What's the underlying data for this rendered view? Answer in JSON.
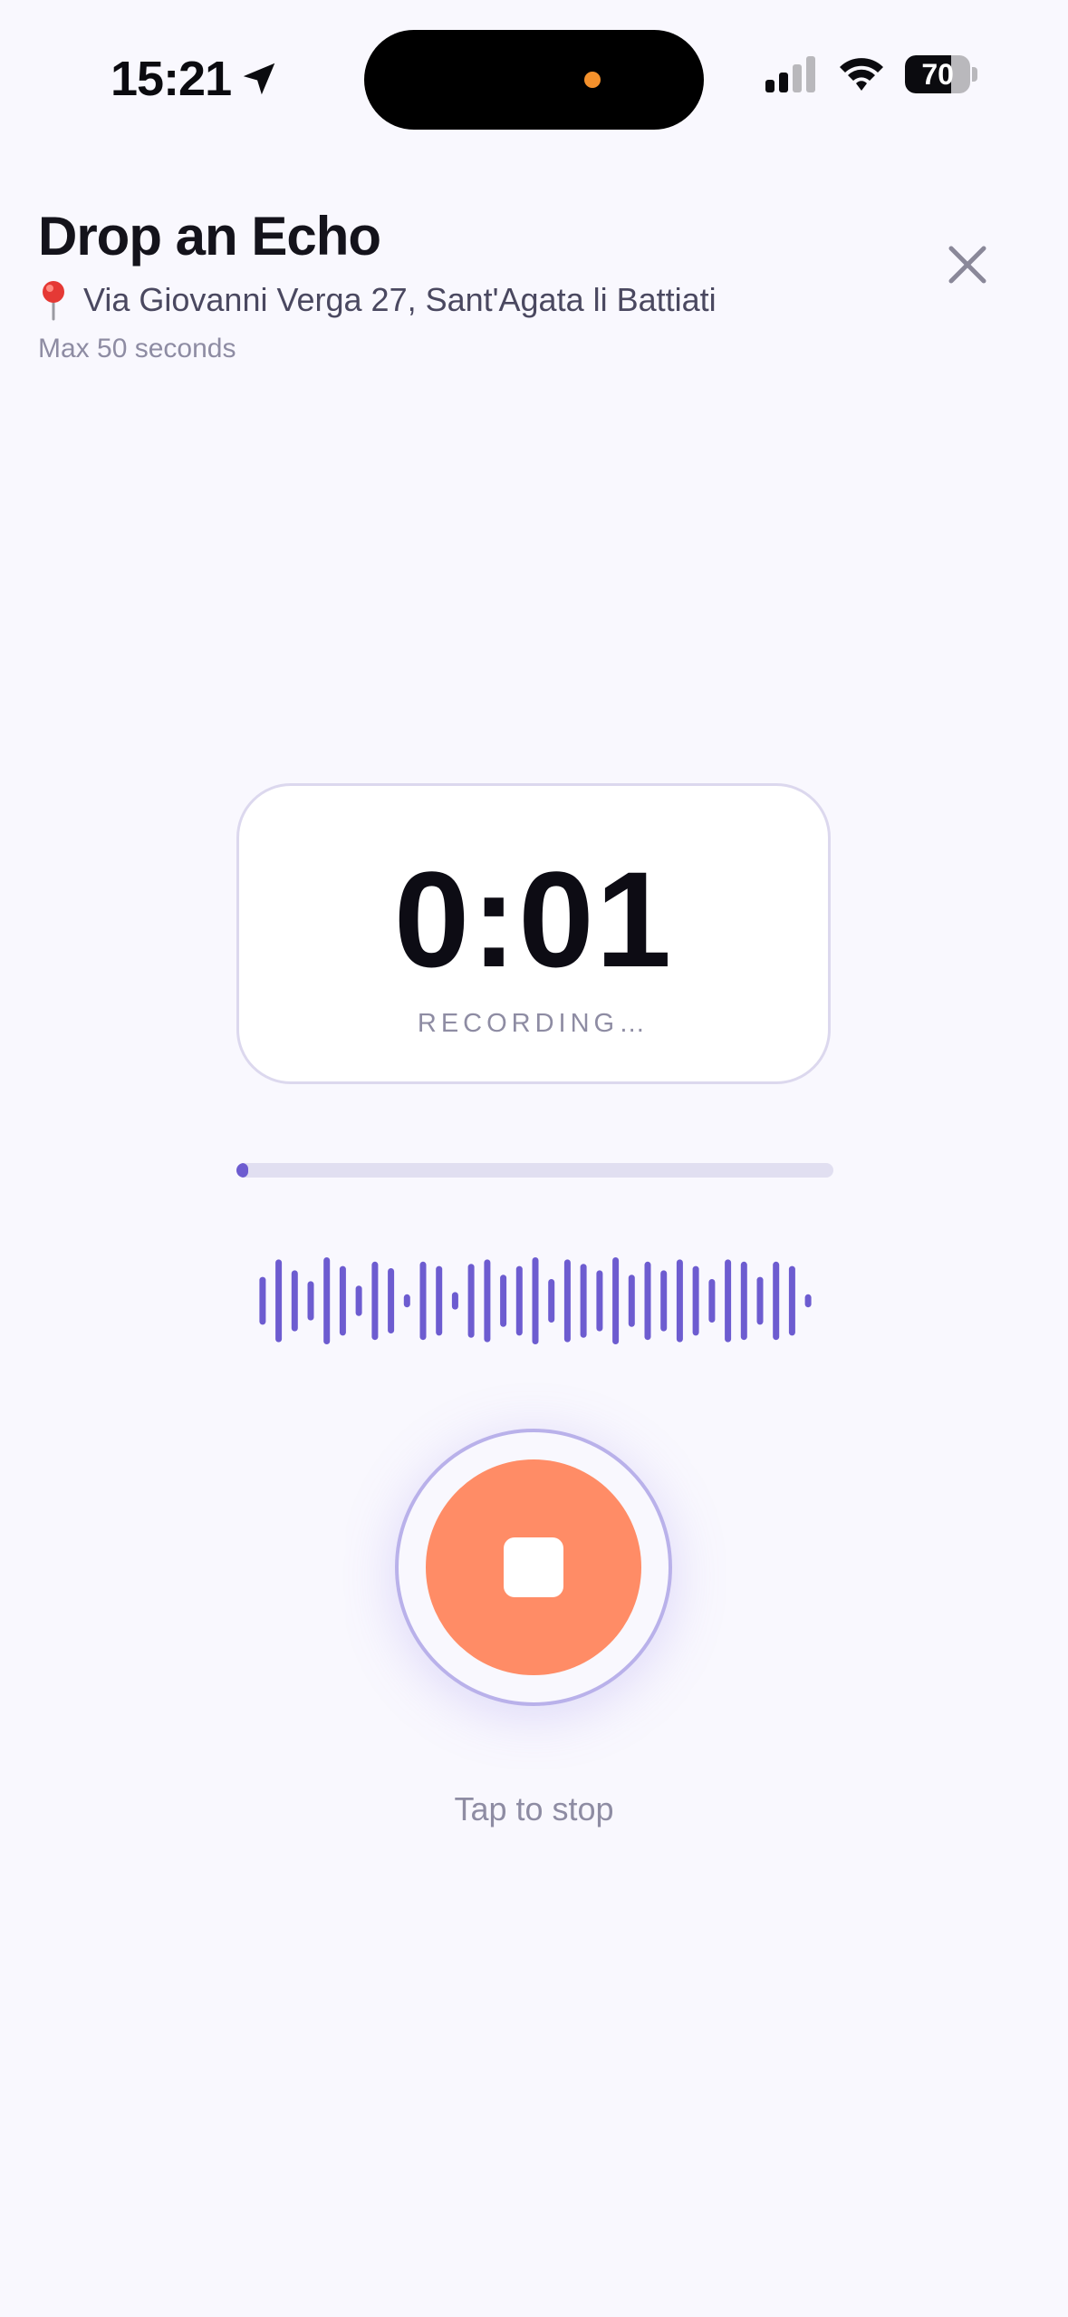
{
  "status_bar": {
    "time": "15:21",
    "battery_level": "70",
    "battery_fraction": 0.7,
    "icons": [
      "location-arrow-icon",
      "signal-icon",
      "wifi-icon",
      "battery-icon"
    ],
    "island_indicator_color": "#f4912c"
  },
  "header": {
    "title": "Drop an Echo",
    "location_icon": "pin-icon",
    "location": "Via Giovanni Verga 27, Sant'Agata li Battiati",
    "max_duration": "Max 50 seconds",
    "close_icon": "close-icon"
  },
  "recorder": {
    "elapsed": "0:01",
    "status": "RECORDING…",
    "progress_fraction": 0.02,
    "waveform_levels": [
      0.55,
      0.95,
      0.7,
      0.45,
      1.0,
      0.8,
      0.35,
      0.9,
      0.75,
      0.15,
      0.9,
      0.8,
      0.2,
      0.85,
      0.95,
      0.6,
      0.8,
      1.0,
      0.5,
      0.95,
      0.85,
      0.7,
      1.0,
      0.6,
      0.9,
      0.7,
      0.95,
      0.8,
      0.5,
      0.95,
      0.9,
      0.55,
      0.9,
      0.8,
      0.15
    ],
    "stop_icon": "stop-icon",
    "hint": "Tap to stop"
  },
  "colors": {
    "accent": "#6d5cd0",
    "record": "#ff8c66",
    "background": "#f9f8fe"
  }
}
